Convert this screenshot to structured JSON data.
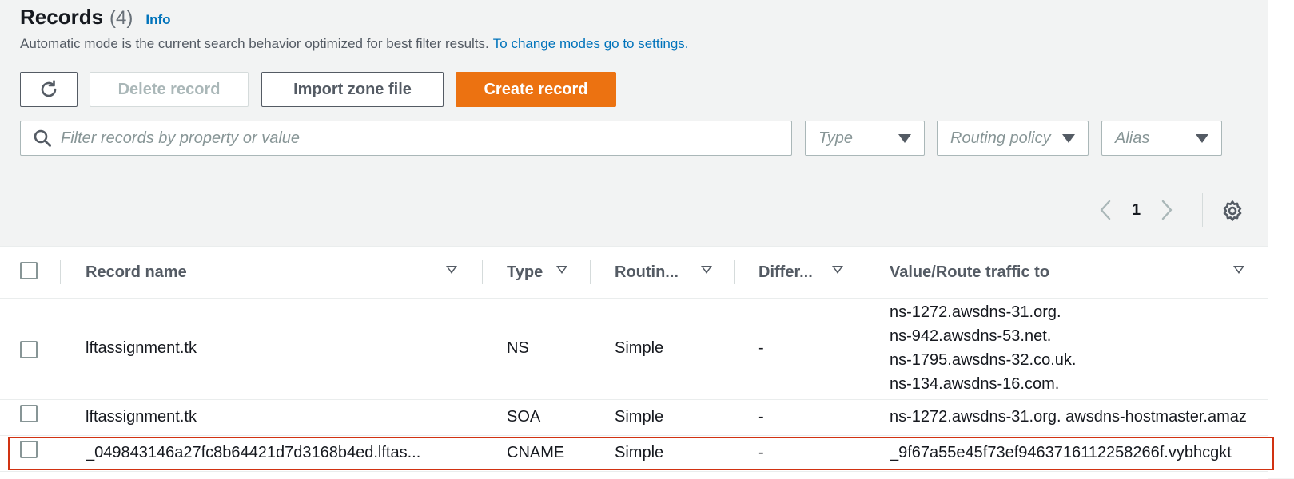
{
  "header": {
    "title": "Records",
    "count": "(4)",
    "info_label": "Info",
    "subtitle": "Automatic mode is the current search behavior optimized for best filter results.",
    "subtitle_link": "To change modes go to settings."
  },
  "toolbar": {
    "refresh_icon": "refresh-icon",
    "delete_label": "Delete record",
    "import_label": "Import zone file",
    "create_label": "Create record"
  },
  "filters": {
    "search_placeholder": "Filter records by property or value",
    "type_placeholder": "Type",
    "routing_placeholder": "Routing policy",
    "alias_placeholder": "Alias"
  },
  "pagination": {
    "current_page": "1"
  },
  "table": {
    "columns": [
      "Record name",
      "Type",
      "Routin...",
      "Differ...",
      "Value/Route traffic to"
    ],
    "rows": [
      {
        "name": "lftassignment.tk",
        "type": "NS",
        "routing": "Simple",
        "differentiator": "-",
        "values": [
          "ns-1272.awsdns-31.org.",
          "ns-942.awsdns-53.net.",
          "ns-1795.awsdns-32.co.uk.",
          "ns-134.awsdns-16.com."
        ]
      },
      {
        "name": "lftassignment.tk",
        "type": "SOA",
        "routing": "Simple",
        "differentiator": "-",
        "values": [
          "ns-1272.awsdns-31.org. awsdns-hostmaster.amaz"
        ]
      },
      {
        "name": "_049843146a27fc8b64421d7d3168b4ed.lftas...",
        "type": "CNAME",
        "routing": "Simple",
        "differentiator": "-",
        "values": [
          "_9f67a55e45f73ef9463716112258266f.vybhcgkt"
        ]
      }
    ]
  },
  "colors": {
    "primary_button": "#ec7211",
    "link": "#0073bb",
    "highlight_border": "#d13212"
  }
}
